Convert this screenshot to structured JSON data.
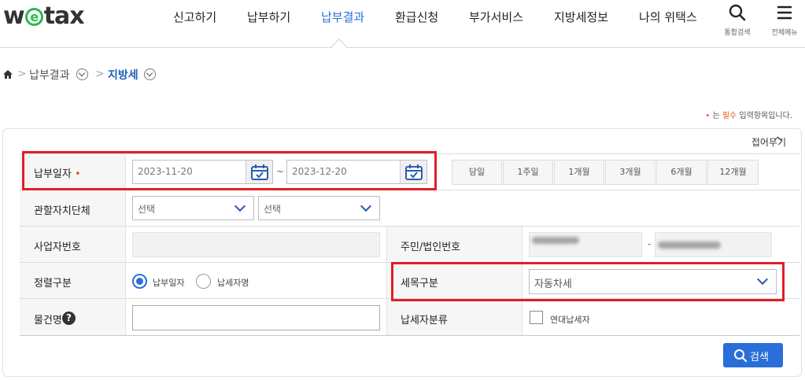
{
  "header": {
    "logo": {
      "pre": "w",
      "mid": "e",
      "post": "tax"
    },
    "nav": [
      "신고하기",
      "납부하기",
      "납부결과",
      "환급신청",
      "부가서비스",
      "지방세정보",
      "나의 위택스"
    ],
    "active_nav": "납부결과",
    "search_label": "통합검색",
    "menu_label": "전체메뉴"
  },
  "breadcrumb": {
    "level1": "납부결과",
    "level2": "지방세"
  },
  "required_note": {
    "dot": "•",
    "pre": "는 ",
    "word": "필수",
    "post": " 입력항목입니다."
  },
  "panel": {
    "fold_label": "접어두기",
    "payment_date": {
      "label": "납부일자",
      "required_mark": "•",
      "from": "2023-11-20",
      "to": "2023-12-20",
      "separator": "~"
    },
    "periods": [
      "당일",
      "1주일",
      "1개월",
      "3개월",
      "6개월",
      "12개월"
    ],
    "jurisdiction": {
      "label": "관할자치단체",
      "select1": "선택",
      "select2": "선택"
    },
    "business_no": {
      "label": "사업자번호",
      "value": ""
    },
    "resident_no": {
      "label": "주민/법인번호",
      "separator": "-"
    },
    "sort": {
      "label": "정렬구분",
      "options": [
        "납부일자",
        "납세자명"
      ],
      "selected": "납부일자"
    },
    "tax_item": {
      "label": "세목구분",
      "value": "자동차세"
    },
    "item_name": {
      "label": "물건명",
      "help": "?",
      "value": ""
    },
    "taxpayer_type": {
      "label": "납세자분류",
      "checkbox_label": "연대납세자",
      "checked": false
    },
    "search_button": "검색"
  },
  "colors": {
    "accent": "#2a6ed9",
    "highlight": "#e01f26",
    "required": "#e8561e",
    "logo_e": "#2db84b"
  }
}
